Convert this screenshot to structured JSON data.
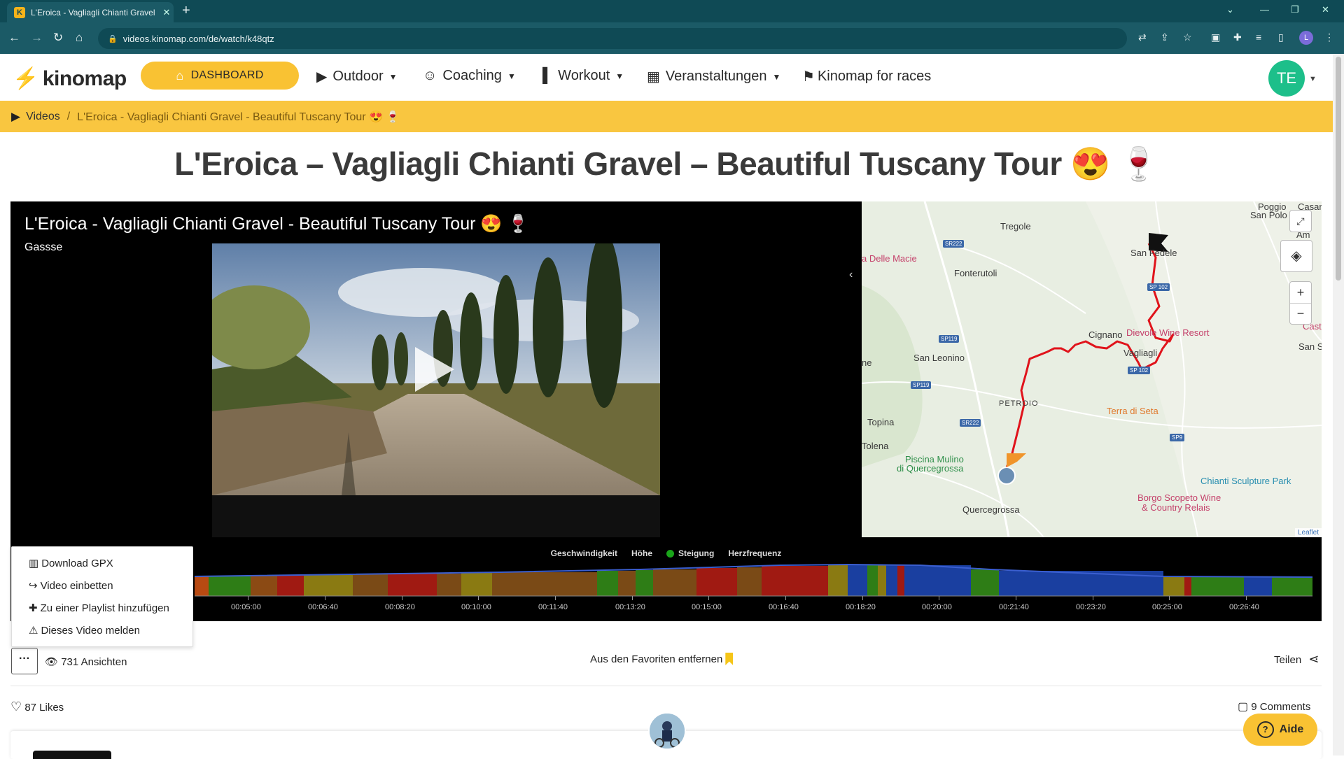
{
  "browser": {
    "tab_title": "L'Eroica - Vagliagli Chianti Gravel",
    "url": "videos.kinomap.com/de/watch/k48qtz",
    "profile_initial": "L"
  },
  "nav": {
    "logo": "kinomap",
    "dashboard": "DASHBOARD",
    "outdoor": "Outdoor",
    "coaching": "Coaching",
    "workout": "Workout",
    "veranstaltungen": "Veranstaltungen",
    "races": "Kinomap for races",
    "user_initials": "TE"
  },
  "breadcrumb": {
    "videos": "Videos",
    "current": "L'Eroica - Vagliagli Chianti Gravel - Beautiful Tuscany Tour 😍 🍷"
  },
  "page_title": "L'Eroica – Vagliagli Chianti Gravel – Beautiful Tuscany Tour 😍 🍷",
  "player": {
    "title": "L'Eroica - Vagliagli Chianti Gravel - Beautiful Tuscany Tour 😍 🍷",
    "author": "Gassse"
  },
  "map": {
    "labels": {
      "tregole": "Tregole",
      "poggio": "Poggio",
      "sanpolo": "San Polo",
      "casano": "Casano",
      "delle_macie": "a Delle Macie",
      "fonterutoli": "Fonterutoli",
      "san_fedele": "San Fedele",
      "cignano": "Cignano",
      "dievole": "Dievole Wine Resort",
      "vagliagli": "Vagliagli",
      "san_leonino": "San Leonino",
      "ne": "ne",
      "san_s": "San S",
      "caste": "Caste",
      "petroio": "PETROIO",
      "terra_di_seta": "Terra di Seta",
      "topina": "Topina",
      "tolena": "Tolena",
      "piscina1": "Piscina Mulino",
      "piscina2": "di Quercegrossa",
      "chianti_park": "Chianti Sculpture Park",
      "borgo1": "Borgo Scopeto Wine",
      "borgo2": "& Country Relais",
      "quercegrossa": "Quercegrossa",
      "am": "Am"
    },
    "roads": {
      "sr222_a": "SR222",
      "sr222_b": "SR222",
      "sp119_a": "SP119",
      "sp119_b": "SP119",
      "sp102_a": "SP 102",
      "sp102_b": "SP 102",
      "sp9": "SP9"
    },
    "attribution": "Leaflet",
    "zoom_in": "+",
    "zoom_out": "−"
  },
  "chart": {
    "legend": {
      "speed": "Geschwindigkeit",
      "height": "Höhe",
      "slope": "Steigung",
      "hr": "Herzfrequenz"
    },
    "ticks": [
      "00:05:00",
      "00:06:40",
      "00:08:20",
      "00:10:00",
      "00:11:40",
      "00:13:20",
      "00:15:00",
      "00:16:40",
      "00:18:20",
      "00:20:00",
      "00:21:40",
      "00:23:20",
      "00:25:00",
      "00:26:40"
    ]
  },
  "menu": {
    "download": "Download GPX",
    "embed": "Video einbetten",
    "playlist": "Zu einer Playlist hinzufügen",
    "report": "Dieses Video melden"
  },
  "meta": {
    "more": "···",
    "views": "731 Ansichten",
    "favorite": "Aus den Favoriten entfernen",
    "share": "Teilen",
    "likes": "87 Likes",
    "comments": "9 Comments",
    "aide": "Aide"
  },
  "colors": {
    "brand_yellow": "#f9c233",
    "breadcrumb_yellow": "#f9c640",
    "avatar_green": "#1dbf8a",
    "browser_teal": "#1b5a66"
  }
}
